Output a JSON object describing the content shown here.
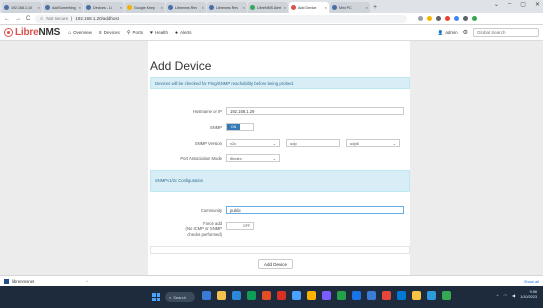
{
  "browser": {
    "tabs": [
      {
        "title": "192.168.1.10",
        "color": "#4a6fa5",
        "active": false
      },
      {
        "title": "AddSomething",
        "color": "#4a6fa5",
        "active": false
      },
      {
        "title": "Devices - Li",
        "color": "#4a6fa5",
        "active": false
      },
      {
        "title": "Google Keep",
        "color": "#f2b400",
        "active": false
      },
      {
        "title": "Librenms Rev",
        "color": "#4a6fa5",
        "active": false
      },
      {
        "title": "Librenms Rev",
        "color": "#4a6fa5",
        "active": false
      },
      {
        "title": "LibreNMS Alert",
        "color": "#34a853",
        "active": false
      },
      {
        "title": "Add Device",
        "color": "#d9534f",
        "active": true
      },
      {
        "title": "Mini PC",
        "color": "#4a6fa5",
        "active": false
      }
    ],
    "new_tab": "+",
    "window_controls": [
      "⌄",
      "–",
      "▢",
      "✕"
    ],
    "nav": {
      "back": "←",
      "forward": "→",
      "reload": "C"
    },
    "address": {
      "security": "Not secure",
      "url": "192.168.1.20/addhost"
    },
    "extension_colors": [
      "#9aa0a6",
      "#f4b400",
      "#5f6368",
      "#ea4335",
      "#4285f4",
      "#5f6368",
      "#34a853"
    ]
  },
  "navbar": {
    "logo_libre": "Libre",
    "logo_nms": "NMS",
    "items": [
      {
        "icon": "home-icon",
        "glyph": "⌂",
        "label": "Overview"
      },
      {
        "icon": "server-icon",
        "glyph": "≡",
        "label": "Devices"
      },
      {
        "icon": "link-icon",
        "glyph": "⚲",
        "label": "Ports"
      },
      {
        "icon": "heart-icon",
        "glyph": "♥",
        "label": "Health"
      },
      {
        "icon": "alert-icon",
        "glyph": "●",
        "label": "Alerts"
      }
    ],
    "user": "admin",
    "search_placeholder": "Global Search"
  },
  "form": {
    "title": "Add Device",
    "notice": "Devices will be checked for Ping/SNMP reachability before being probed.",
    "hostname_label": "Hostname or IP",
    "hostname_value": "192.168.1.29",
    "snmp_label": "SNMP",
    "snmp_state": "ON",
    "snmp_version_label": "SNMP Version",
    "snmp_version_value": "v2c",
    "snmp_transport_value": "udp",
    "snmp_port_value": "udp6",
    "port_assoc_label": "Port Association Mode",
    "port_assoc_value": "ifIndex",
    "section_title": "SNMPv1/2c Configuration",
    "community_label": "Community",
    "community_value": "public",
    "force_label": "Force add",
    "force_sub1": "(No ICMP or SNMP",
    "force_sub2": "checks performed)",
    "force_state": "OFF",
    "submit_label": "Add Device"
  },
  "downloads": {
    "file_name": "librenmsnet",
    "show_all": "Show all"
  },
  "taskbar": {
    "search_label": "Search",
    "icon_colors": [
      "#3a7bd5",
      "#f2c14e",
      "#2b88d8",
      "#0f9d58",
      "#e44d26",
      "#d93025",
      "#4aa3ff",
      "#ffb300",
      "#7a5cff",
      "#24a148",
      "#1a73e8",
      "#3a7bd5",
      "#e8453c",
      "#0078d4",
      "#f6c343",
      "#2d9cdb",
      "#34a853"
    ],
    "time": "9:56",
    "date": "1/10/2023"
  }
}
